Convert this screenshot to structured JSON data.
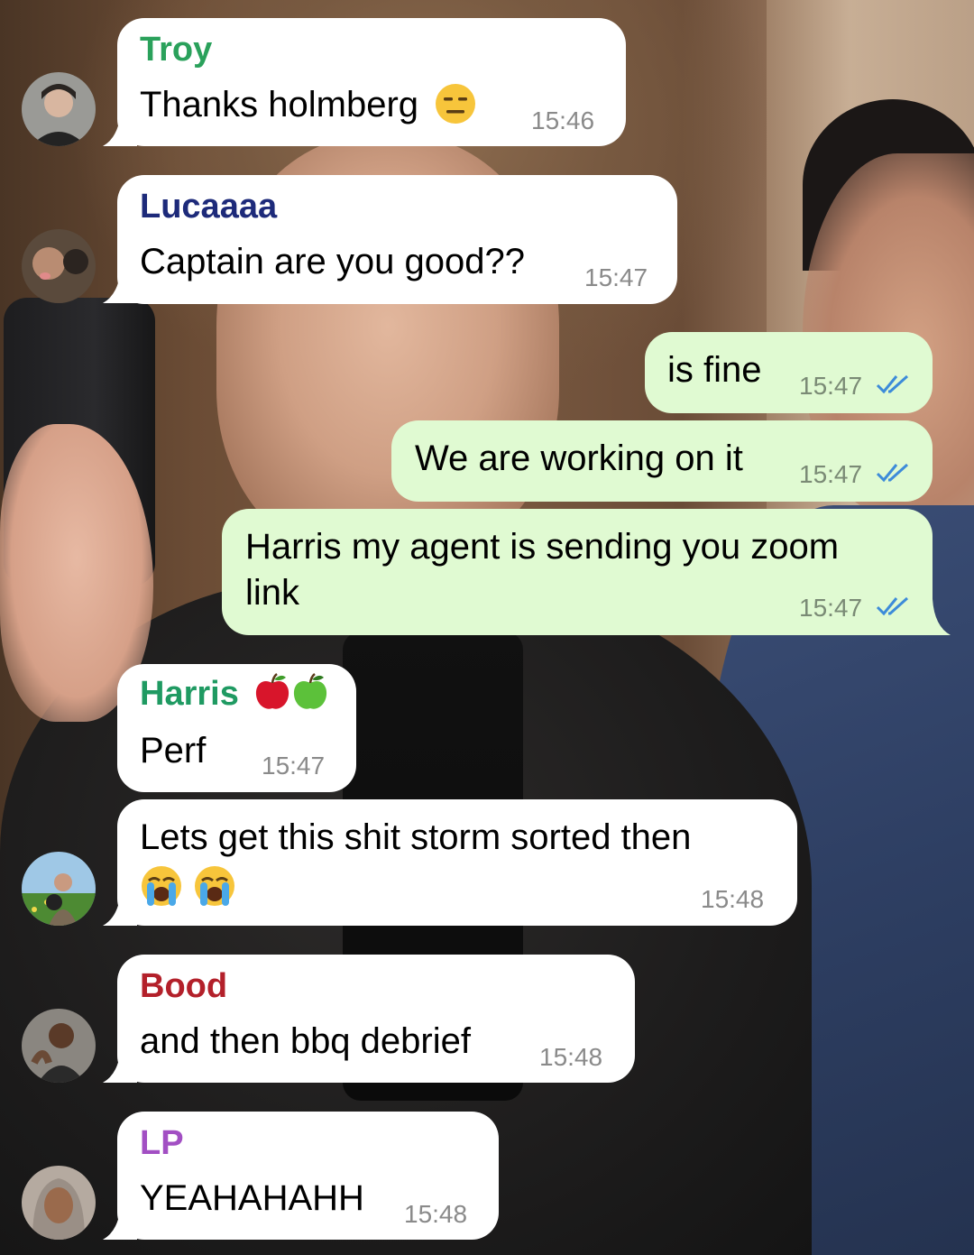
{
  "messages": [
    {
      "id": "m1",
      "direction": "in",
      "sender": "Troy",
      "sender_color": "#2aa15b",
      "text": "Thanks holmberg",
      "emoji": "expressionless-face",
      "time": "15:46"
    },
    {
      "id": "m2",
      "direction": "in",
      "sender": "Lucaaaa",
      "sender_color": "#1d2a7a",
      "text": "Captain are you good??",
      "time": "15:47"
    },
    {
      "id": "m3",
      "direction": "out",
      "text": "is fine",
      "time": "15:47",
      "status": "read"
    },
    {
      "id": "m4",
      "direction": "out",
      "text": "We are working on it",
      "time": "15:47",
      "status": "read"
    },
    {
      "id": "m5",
      "direction": "out",
      "text_line1": "Harris my agent is sending you zoom",
      "text_line2": "link",
      "time": "15:47",
      "status": "read"
    },
    {
      "id": "m6",
      "direction": "in",
      "sender": "Harris",
      "sender_emojis": [
        "red-apple",
        "green-apple"
      ],
      "sender_color": "#1f9a62",
      "text": "Perf",
      "time": "15:47"
    },
    {
      "id": "m7",
      "direction": "in",
      "text": "Lets get this shit storm sorted then",
      "emojis": [
        "loudly-crying-face",
        "loudly-crying-face"
      ],
      "time": "15:48"
    },
    {
      "id": "m8",
      "direction": "in",
      "sender": "Bood",
      "sender_color": "#b3202a",
      "text": "and then bbq debrief",
      "time": "15:48"
    },
    {
      "id": "m9",
      "direction": "in",
      "sender": "LP",
      "sender_color": "#a24fc3",
      "text": "YEAHAHAHH",
      "time": "15:48"
    }
  ],
  "colors": {
    "incoming_bubble": "#ffffff",
    "outgoing_bubble": "#e0fad2",
    "read_ticks": "#3d8bd9",
    "timestamp": "#8a8a8a"
  }
}
